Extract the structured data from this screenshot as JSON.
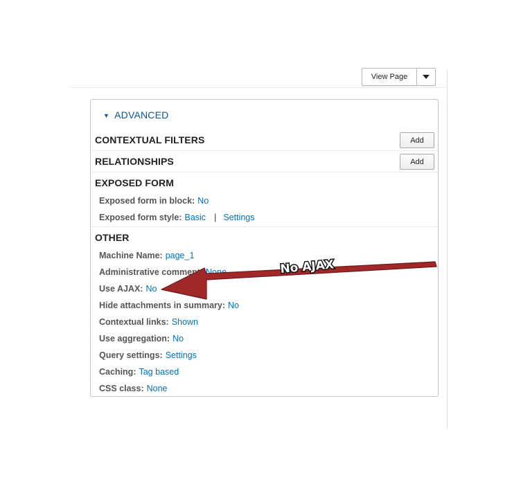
{
  "toolbar": {
    "view_page_label": "View Page"
  },
  "advanced": {
    "toggle_label": "ADVANCED",
    "contextual_filters": {
      "title": "CONTEXTUAL FILTERS",
      "add_label": "Add"
    },
    "relationships": {
      "title": "RELATIONSHIPS",
      "add_label": "Add"
    },
    "exposed_form": {
      "title": "EXPOSED FORM",
      "in_block": {
        "label": "Exposed form in block:",
        "value": "No"
      },
      "style": {
        "label": "Exposed form style:",
        "value": "Basic",
        "separator": "|",
        "settings": "Settings"
      }
    },
    "other": {
      "title": "OTHER",
      "rows": [
        {
          "label": "Machine Name:",
          "value": "page_1"
        },
        {
          "label": "Administrative comment:",
          "value": "None"
        },
        {
          "label": "Use AJAX:",
          "value": "No"
        },
        {
          "label": "Hide attachments in summary:",
          "value": "No"
        },
        {
          "label": "Contextual links:",
          "value": "Shown"
        },
        {
          "label": "Use aggregation:",
          "value": "No"
        },
        {
          "label": "Query settings:",
          "value": "Settings"
        },
        {
          "label": "Caching:",
          "value": "Tag based"
        },
        {
          "label": "CSS class:",
          "value": "None"
        }
      ]
    }
  },
  "annotation": {
    "text": "No AJAX",
    "arrow_color": "#a02828"
  }
}
